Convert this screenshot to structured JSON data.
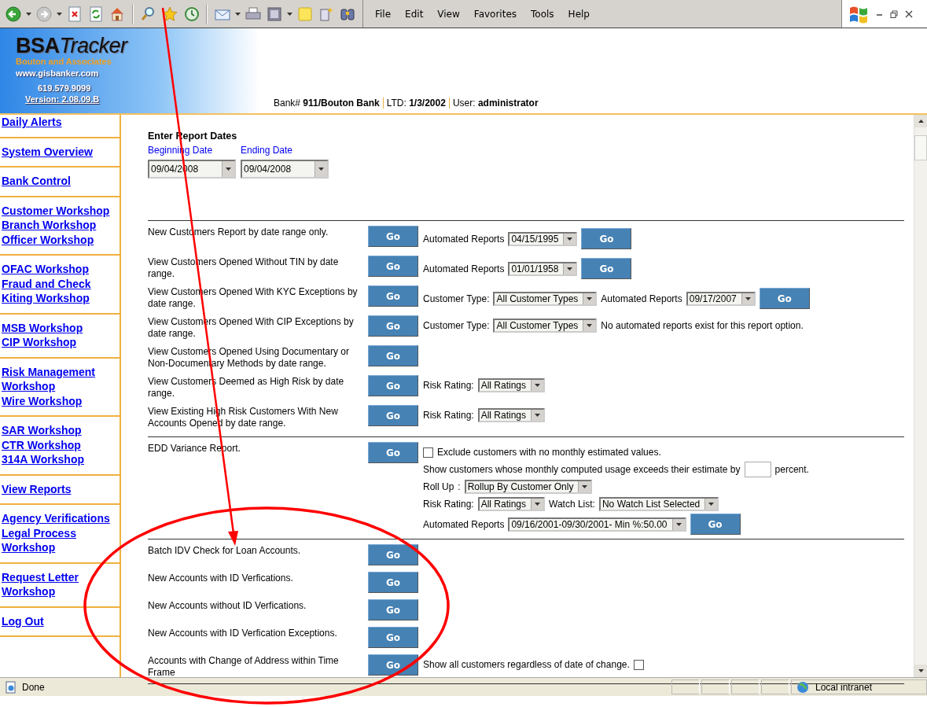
{
  "browser": {
    "menu": [
      "File",
      "Edit",
      "View",
      "Favorites",
      "Tools",
      "Help"
    ]
  },
  "header": {
    "logo_prefix": "BSA",
    "logo_suffix": "Tracker",
    "company": "Bouton and Associates",
    "website": "www.gisbanker.com",
    "phone": "619.579.9099",
    "version": "Version: 2.08.09.B",
    "info": [
      "Bank# **911/Bouton Bank**",
      "LTD: **1/3/2002**",
      "User: **administrator**"
    ]
  },
  "sidebar": {
    "groups": [
      {
        "links": [
          "Daily Alerts"
        ]
      },
      {
        "links": [
          "System Overview"
        ]
      },
      {
        "links": [
          "Bank Control"
        ]
      },
      {
        "links": [
          "Customer Workshop",
          "Branch Workshop",
          "Officer Workshop"
        ]
      },
      {
        "links": [
          "OFAC Workshop",
          "Fraud and Check Kiting Workshop"
        ]
      },
      {
        "links": [
          "MSB Workshop",
          "CIP Workshop"
        ]
      },
      {
        "links": [
          "Risk Management Workshop",
          "Wire Workshop"
        ]
      },
      {
        "links": [
          "SAR Workshop",
          "CTR Workshop",
          "314A Workshop"
        ]
      },
      {
        "links": [
          "View Reports"
        ]
      },
      {
        "links": [
          "Agency Verifications",
          "Legal Process Workshop"
        ]
      },
      {
        "links": [
          "Request Letter Workshop"
        ]
      },
      {
        "links": [
          "Log Out"
        ]
      }
    ]
  },
  "report_dates": {
    "title": "Enter Report Dates",
    "fields": [
      {
        "label": "Beginning Date",
        "value": "09/04/2008"
      },
      {
        "label": "Ending Date",
        "value": "09/04/2008"
      }
    ]
  },
  "sections": [
    {
      "rows": [
        {
          "description": "New Customers Report by date range only.",
          "button": "Go",
          "lines": [
            [
              {
                "kind": "label",
                "text": "Automated Reports"
              },
              {
                "kind": "select",
                "value": "04/15/1995"
              },
              {
                "kind": "button",
                "text": "Go"
              }
            ]
          ]
        },
        {
          "description": "View Customers Opened Without TIN by date range.",
          "button": "Go",
          "lines": [
            [
              {
                "kind": "label",
                "text": "Automated Reports"
              },
              {
                "kind": "select",
                "value": "01/01/1958"
              },
              {
                "kind": "button",
                "text": "Go"
              }
            ]
          ]
        },
        {
          "description": "View Customers Opened With KYC Exceptions by date range.",
          "button": "Go",
          "lines": [
            [
              {
                "kind": "label",
                "text": "Customer Type:"
              },
              {
                "kind": "select",
                "value": "All Customer Types"
              },
              {
                "kind": "label",
                "text": "Automated Reports"
              },
              {
                "kind": "select",
                "value": "09/17/2007"
              },
              {
                "kind": "button",
                "text": "Go"
              }
            ]
          ]
        },
        {
          "description": "View Customers Opened With CIP Exceptions by date range.",
          "button": "Go",
          "lines": [
            [
              {
                "kind": "label",
                "text": "Customer Type:"
              },
              {
                "kind": "select",
                "value": "All Customer Types"
              },
              {
                "kind": "label",
                "text": "No automated reports exist for this report option."
              }
            ]
          ]
        },
        {
          "description": "View Customers Opened Using Documentary or Non-Documentary Methods by date range.",
          "button": "Go"
        },
        {
          "description": "View Customers Deemed as High Risk by date range.",
          "button": "Go",
          "lines": [
            [
              {
                "kind": "label",
                "text": "Risk Rating:"
              },
              {
                "kind": "select",
                "value": "All Ratings"
              }
            ]
          ]
        },
        {
          "description": "View Existing High Risk Customers With New Accounts Opened by date range.",
          "button": "Go",
          "lines": [
            [
              {
                "kind": "label",
                "text": "Risk Rating:"
              },
              {
                "kind": "select",
                "value": "All Ratings"
              }
            ]
          ]
        }
      ]
    },
    {
      "rows": [
        {
          "description": "EDD Variance Report.",
          "button": "Go",
          "lines": [
            [
              {
                "kind": "checkbox",
                "checked": false
              },
              {
                "kind": "label",
                "text": "Exclude customers with no monthly estimated values."
              }
            ],
            [
              {
                "kind": "label",
                "text": "Show customers whose monthly computed usage exceeds their estimate by"
              },
              {
                "kind": "input"
              },
              {
                "kind": "label",
                "text": "percent."
              }
            ],
            [
              {
                "kind": "label",
                "text": "Roll Up"
              },
              {
                "kind": "label",
                "text": ":"
              },
              {
                "kind": "select",
                "value": "Rollup By Customer Only"
              }
            ],
            [
              {
                "kind": "label",
                "text": "Risk Rating:"
              },
              {
                "kind": "select",
                "value": "All Ratings"
              },
              {
                "kind": "label",
                "text": "Watch List:"
              },
              {
                "kind": "select",
                "value": "No Watch List Selected"
              }
            ],
            [
              {
                "kind": "label",
                "text": "Automated Reports"
              },
              {
                "kind": "select",
                "value": "09/16/2001-09/30/2001- Min %:50.00"
              },
              {
                "kind": "button",
                "text": "Go"
              }
            ]
          ]
        }
      ]
    },
    {
      "rows": [
        {
          "description": "Batch IDV Check for Loan Accounts.",
          "button": "Go"
        },
        {
          "description": "New Accounts with ID Verfications.",
          "button": "Go"
        },
        {
          "description": "New Accounts without ID Verfications.",
          "button": "Go"
        },
        {
          "description": "New Accounts with ID Verfication Exceptions.",
          "button": "Go"
        },
        {
          "description": "Accounts with Change of Address within Time Frame",
          "button": "Go",
          "lines": [
            [
              {
                "kind": "label",
                "text": "Show all customers regardless of date of change."
              },
              {
                "kind": "checkbox",
                "checked": false
              }
            ]
          ]
        }
      ]
    }
  ],
  "status_bar": {
    "status": "Done",
    "zone": "Local intranet"
  }
}
